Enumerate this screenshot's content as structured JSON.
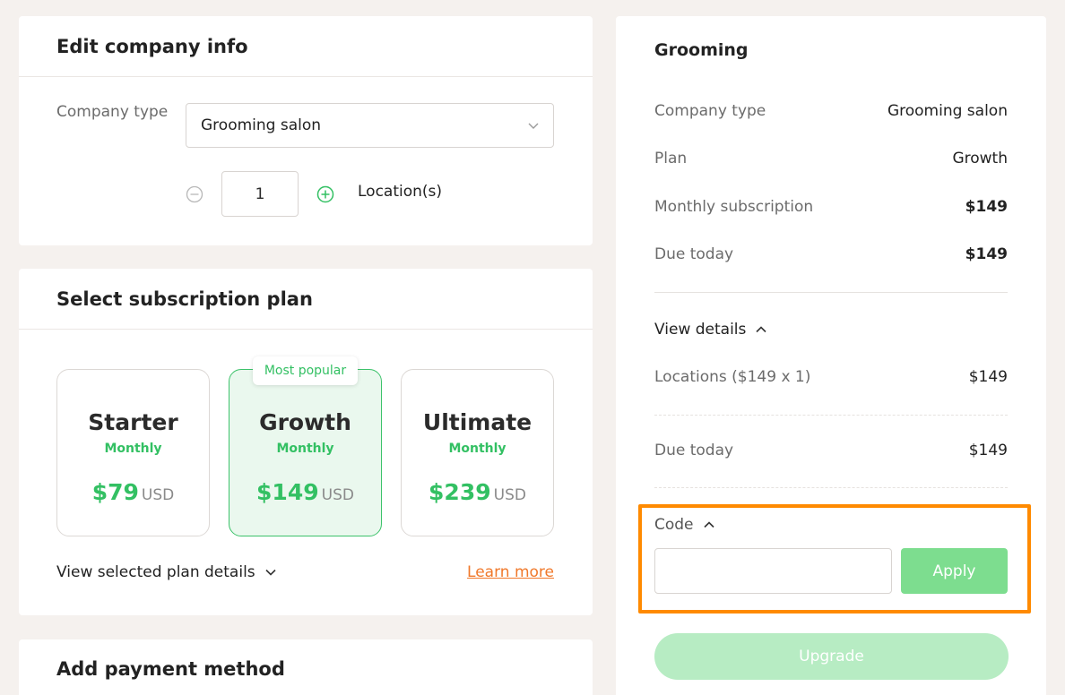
{
  "company_card": {
    "title": "Edit company info",
    "company_type_label": "Company type",
    "company_type_value": "Grooming salon",
    "locations_count": "1",
    "locations_label": "Location(s)"
  },
  "plan_card": {
    "title": "Select subscription plan",
    "badge": "Most popular",
    "plans": [
      {
        "name": "Starter",
        "frequency": "Monthly",
        "price": "$79",
        "currency": "USD",
        "selected": false
      },
      {
        "name": "Growth",
        "frequency": "Monthly",
        "price": "$149",
        "currency": "USD",
        "selected": true
      },
      {
        "name": "Ultimate",
        "frequency": "Monthly",
        "price": "$239",
        "currency": "USD",
        "selected": false
      }
    ],
    "view_details_label": "View selected plan details",
    "learn_more_label": "Learn more"
  },
  "payment_card": {
    "title": "Add payment method"
  },
  "summary": {
    "title": "Grooming",
    "rows": [
      {
        "label": "Company type",
        "value": "Grooming salon"
      },
      {
        "label": "Plan",
        "value": "Growth"
      },
      {
        "label": "Monthly subscription",
        "value": "$149"
      },
      {
        "label": "Due today",
        "value": "$149"
      }
    ],
    "view_details_label": "View details",
    "locations_row": {
      "label": "Locations ($149 x 1)",
      "value": "$149"
    },
    "due_today_row": {
      "label": "Due today",
      "value": "$149"
    },
    "code_label": "Code",
    "apply_label": "Apply",
    "upgrade_label": "Upgrade"
  },
  "colors": {
    "accent_green": "#33c063",
    "apply_green": "#7ddd8f",
    "upgrade_green": "#b7ecc3",
    "link_orange": "#f0782a",
    "highlight_orange": "#ff8a00",
    "background": "#f5f1ee"
  }
}
